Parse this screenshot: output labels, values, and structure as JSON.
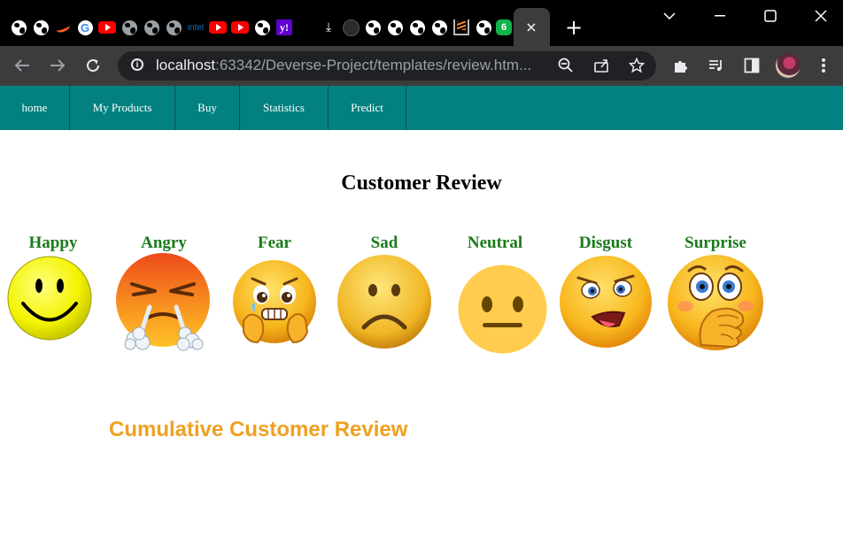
{
  "browser": {
    "url_host": "localhost",
    "url_rest": ":63342/Deverse-Project/templates/review.htm...",
    "tab_close": "×",
    "new_tab": "+",
    "favicons": [
      "globe-icon",
      "globe-icon",
      "swoosh-icon",
      "google-icon",
      "youtube-icon",
      "globe-icon",
      "globe-icon",
      "globe-icon",
      "intel-icon",
      "youtube-icon",
      "youtube-icon",
      "globe-icon",
      "yahoo-icon",
      "download-icon",
      "github-icon",
      "globe-icon",
      "globe-icon",
      "globe-icon",
      "globe-icon",
      "stackoverflow-icon",
      "globe-icon",
      "badge-6-icon"
    ],
    "intel_text": "intel",
    "yahoo_text": "y!",
    "badge_text": "6",
    "g_text": "G"
  },
  "nav": {
    "items": [
      {
        "label": "home"
      },
      {
        "label": "My Products"
      },
      {
        "label": "Buy"
      },
      {
        "label": "Statistics"
      },
      {
        "label": "Predict"
      }
    ]
  },
  "page": {
    "title": "Customer Review",
    "emotions": [
      {
        "label": "Happy"
      },
      {
        "label": "Angry"
      },
      {
        "label": "Fear"
      },
      {
        "label": "Sad"
      },
      {
        "label": "Neutral"
      },
      {
        "label": "Disgust"
      },
      {
        "label": "Surprise"
      }
    ],
    "cumulative_title": "Cumulative Customer Review"
  },
  "colors": {
    "nav_bg": "#038080",
    "emotion_label": "#1a7a1a",
    "cumulative_title": "#f0a020"
  }
}
